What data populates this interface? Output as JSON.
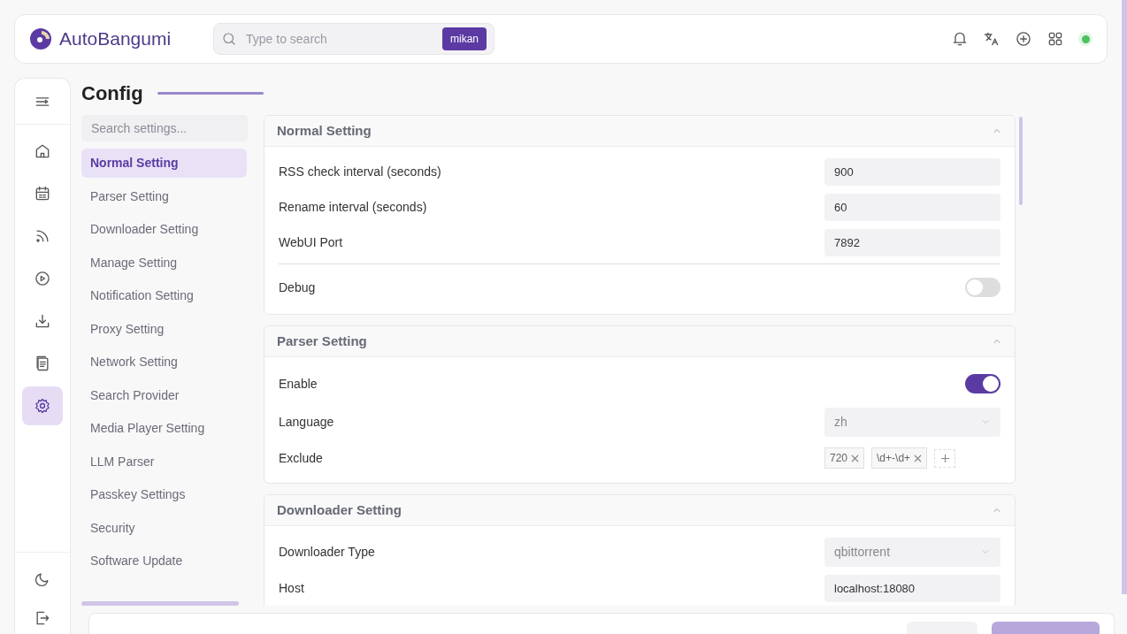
{
  "header": {
    "logo_text": "AutoBangumi",
    "search": {
      "placeholder": "Type to search",
      "source": "mikan"
    },
    "actions": [
      {
        "kind": "bell"
      },
      {
        "kind": "translate"
      },
      {
        "kind": "add"
      },
      {
        "kind": "apps"
      }
    ],
    "online": true
  },
  "rail": {
    "items": [
      {
        "kind": "home",
        "selected": false
      },
      {
        "kind": "calendar",
        "selected": false
      },
      {
        "kind": "rss",
        "selected": false
      },
      {
        "kind": "player",
        "selected": false
      },
      {
        "kind": "download",
        "selected": false
      },
      {
        "kind": "log",
        "selected": false
      },
      {
        "kind": "settings",
        "selected": true
      }
    ],
    "bottom": [
      {
        "kind": "moon"
      },
      {
        "kind": "logout"
      }
    ]
  },
  "page_title": "Config",
  "settings_nav": {
    "search": {
      "placeholder": "Search settings..."
    },
    "items": [
      {
        "label": "Normal Setting",
        "selected": true
      },
      {
        "label": "Parser Setting",
        "selected": false
      },
      {
        "label": "Downloader Setting",
        "selected": false
      },
      {
        "label": "Manage Setting",
        "selected": false
      },
      {
        "label": "Notification Setting",
        "selected": false
      },
      {
        "label": "Proxy Setting",
        "selected": false
      },
      {
        "label": "Network Setting",
        "selected": false
      },
      {
        "label": "Search Provider",
        "selected": false
      },
      {
        "label": "Media Player Setting",
        "selected": false
      },
      {
        "label": "LLM Parser",
        "selected": false
      },
      {
        "label": "Passkey Settings",
        "selected": false
      },
      {
        "label": "Security",
        "selected": false
      },
      {
        "label": "Software Update",
        "selected": false
      }
    ]
  },
  "sections": [
    {
      "title": "Normal Setting",
      "expanded": true,
      "rows": [
        {
          "kind": "input",
          "label": "RSS check interval (seconds)",
          "value": "900"
        },
        {
          "kind": "input",
          "label": "Rename interval (seconds)",
          "value": "60"
        },
        {
          "kind": "input",
          "label": "WebUI Port",
          "value": "7892"
        },
        {
          "kind": "divider"
        },
        {
          "kind": "toggle",
          "label": "Debug",
          "on": false
        }
      ]
    },
    {
      "title": "Parser Setting",
      "expanded": true,
      "rows": [
        {
          "kind": "toggle",
          "label": "Enable",
          "on": true
        },
        {
          "kind": "select",
          "label": "Language",
          "value": "zh"
        },
        {
          "kind": "tags",
          "label": "Exclude",
          "tags": [
            "720",
            "\\d+-\\d+"
          ]
        }
      ]
    },
    {
      "title": "Downloader Setting",
      "expanded": true,
      "rows": [
        {
          "kind": "select",
          "label": "Downloader Type",
          "value": "qbittorrent"
        },
        {
          "kind": "input",
          "label": "Host",
          "value": "localhost:18080"
        }
      ]
    }
  ]
}
